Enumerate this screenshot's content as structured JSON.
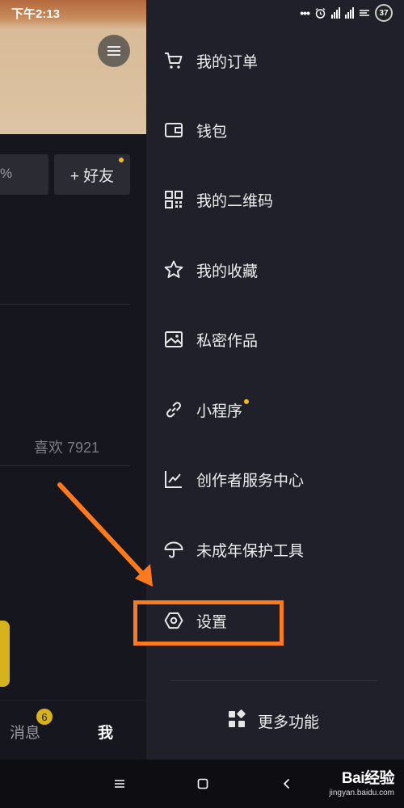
{
  "status_bar": {
    "time": "下午2:13",
    "dots": "•••",
    "battery": "37"
  },
  "profile": {
    "percent_text": "%",
    "add_friend": "+ 好友",
    "likes": "喜欢 7921",
    "tabs": {
      "messages": "消息",
      "messages_badge": "6",
      "me": "我"
    }
  },
  "drawer": {
    "items": [
      {
        "label": "我的订单",
        "icon": "cart-icon"
      },
      {
        "label": "钱包",
        "icon": "wallet-icon"
      },
      {
        "label": "我的二维码",
        "icon": "qrcode-icon"
      },
      {
        "label": "我的收藏",
        "icon": "star-icon"
      },
      {
        "label": "私密作品",
        "icon": "private-image-icon"
      },
      {
        "label": "小程序",
        "icon": "link-icon",
        "has_dot": true
      },
      {
        "label": "创作者服务中心",
        "icon": "chart-icon"
      },
      {
        "label": "未成年保护工具",
        "icon": "umbrella-icon"
      },
      {
        "label": "设置",
        "icon": "settings-hex-icon"
      }
    ],
    "more": {
      "label": "更多功能",
      "icon": "grid-icon"
    }
  },
  "watermark": {
    "brand": "Bai经验",
    "site": "jingyan.baidu.com"
  },
  "colors": {
    "drawer_bg": "#20202a",
    "page_bg": "#16161e",
    "accent_dot": "#f5b825",
    "annotation": "#ff7a1c"
  }
}
